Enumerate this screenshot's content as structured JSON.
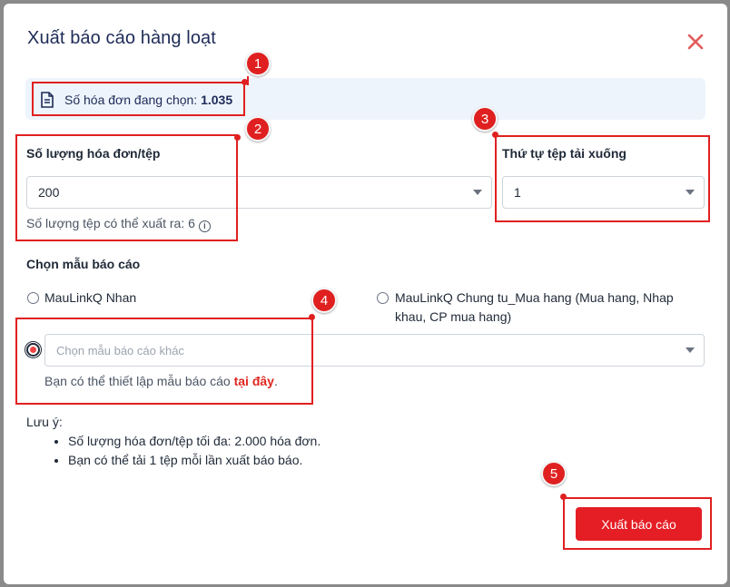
{
  "dialog": {
    "title": "Xuất báo cáo hàng loạt",
    "close_icon": "close-icon",
    "accent_color": "#e51e25"
  },
  "info": {
    "icon": "document-icon",
    "label": "Số hóa đơn đang chọn: ",
    "count": "1.035"
  },
  "invoices_per_file": {
    "label": "Số lượng hóa đơn/tệp",
    "value": "200",
    "hint": "Số lượng tệp có thể xuất ra: 6"
  },
  "download_order": {
    "label": "Thứ tự tệp tải xuống",
    "value": "1"
  },
  "template": {
    "section_label": "Chọn mẫu báo cáo",
    "option_1": "MauLinkQ Nhan",
    "option_2": "MauLinkQ Chung tu_Mua hang (Mua hang, Nhap khau, CP mua hang)",
    "other_placeholder": "Chọn mẫu báo cáo khác",
    "setup_hint_prefix": "Bạn có thể thiết lập mẫu báo cáo ",
    "setup_link": "tại đây",
    "setup_hint_suffix": "."
  },
  "notes": {
    "heading": "Lưu ý:",
    "items": [
      "Số lượng hóa đơn/tệp tối đa: 2.000 hóa đơn.",
      "Bạn có thể tải 1 tệp mỗi lần xuất báo báo."
    ]
  },
  "submit_label": "Xuất báo cáo",
  "callouts": [
    "1",
    "2",
    "3",
    "4",
    "5"
  ]
}
